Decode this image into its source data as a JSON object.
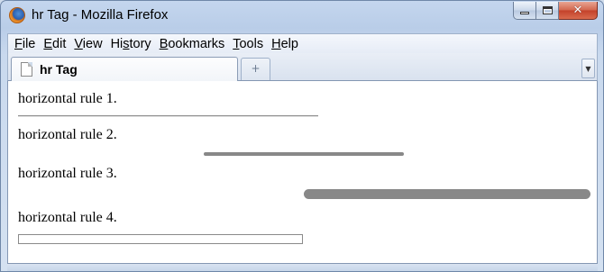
{
  "window": {
    "title": "hr Tag - Mozilla Firefox",
    "app_icon": "firefox-icon",
    "minimize_glyph": "minimize-icon",
    "maximize_glyph": "maximize-icon",
    "close_glyph": "✕"
  },
  "menubar": {
    "items": [
      {
        "accel": "F",
        "rest": "ile"
      },
      {
        "accel": "E",
        "rest": "dit"
      },
      {
        "accel": "V",
        "rest": "iew"
      },
      {
        "pre": "Hi",
        "accel": "s",
        "rest": "tory"
      },
      {
        "accel": "B",
        "rest": "ookmarks"
      },
      {
        "accel": "T",
        "rest": "ools"
      },
      {
        "accel": "H",
        "rest": "elp"
      }
    ]
  },
  "tabs": {
    "active_label": "hr Tag",
    "new_tab_glyph": "+",
    "list_glyph": "▼"
  },
  "content": {
    "paragraphs": [
      "horizontal rule 1.",
      "horizontal rule 2.",
      "horizontal rule 3.",
      "horizontal rule 4."
    ],
    "rule_color": "#888888"
  }
}
